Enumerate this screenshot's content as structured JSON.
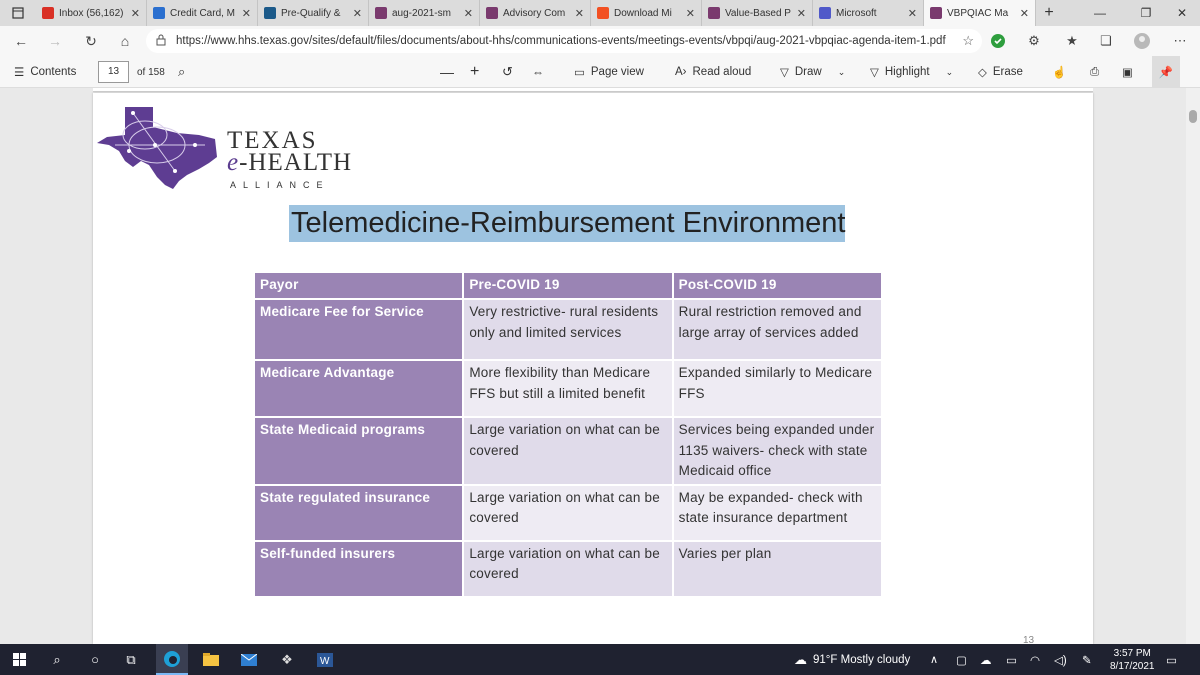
{
  "browser": {
    "tabs": [
      {
        "title": "Inbox (56,162)",
        "icon": "gmail-icon",
        "color": "#d93025"
      },
      {
        "title": "Credit Card, M",
        "icon": "bank-icon",
        "color": "#2a6fcf"
      },
      {
        "title": "Pre-Qualify &",
        "icon": "chart-icon",
        "color": "#1c5a8a"
      },
      {
        "title": "aug-2021-sm",
        "icon": "pdf-icon",
        "color": "#7a3a6e"
      },
      {
        "title": "Advisory Com",
        "icon": "pdf-icon",
        "color": "#7a3a6e"
      },
      {
        "title": "Download Mi",
        "icon": "microsoft-icon",
        "color": "#f25022"
      },
      {
        "title": "Value-Based P",
        "icon": "pdf-icon",
        "color": "#7a3a6e"
      },
      {
        "title": "Microsoft",
        "icon": "teams-icon",
        "color": "#5059c9"
      },
      {
        "title": "VBPQIAC Ma",
        "icon": "pdf-icon",
        "color": "#7a3a6e",
        "active": true
      }
    ],
    "url": "https://www.hhs.texas.gov/sites/default/files/documents/about-hhs/communications-events/meetings-events/vbpqi/aug-2021-vbpqiac-agenda-item-1.pdf"
  },
  "pdf_toolbar": {
    "contents_label": "Contents",
    "page_current": "13",
    "page_total": "of 158",
    "page_view_label": "Page view",
    "read_aloud_label": "Read aloud",
    "draw_label": "Draw",
    "highlight_label": "Highlight",
    "erase_label": "Erase"
  },
  "slide": {
    "logo_line1": "TEXAS",
    "logo_line2_e": "e",
    "logo_line2_rest": "-HEALTH",
    "logo_line3": "ALLIANCE",
    "title": "Telemedicine-Reimbursement Environment",
    "headers": [
      "Payor",
      "Pre-COVID 19",
      "Post-COVID 19"
    ],
    "rows": [
      {
        "payor": "Medicare Fee for Service",
        "pre": "Very restrictive- rural residents only and limited services",
        "post": "Rural restriction removed and large array of services added"
      },
      {
        "payor": "Medicare Advantage",
        "pre": "More flexibility than Medicare FFS but still a limited benefit",
        "post": "Expanded similarly to Medicare FFS"
      },
      {
        "payor": "State Medicaid programs",
        "pre": "Large variation on what can be covered",
        "post": "Services being expanded under 1135 waivers- check with state Medicaid office"
      },
      {
        "payor": "State regulated insurance",
        "pre": "Large variation on what can be covered",
        "post": "May be expanded- check with state insurance department"
      },
      {
        "payor": "Self-funded insurers",
        "pre": "Large variation on what can be covered",
        "post": "Varies per plan"
      }
    ],
    "page_number": "13"
  },
  "taskbar": {
    "weather": "91°F  Mostly cloudy",
    "time": "3:57 PM",
    "date": "8/17/2021"
  },
  "colors": {
    "table_header": "#9a84b4",
    "cell_light": "#e0dbea",
    "cell_lighter": "#eeebf3",
    "title_highlight": "#9dc3e0"
  }
}
